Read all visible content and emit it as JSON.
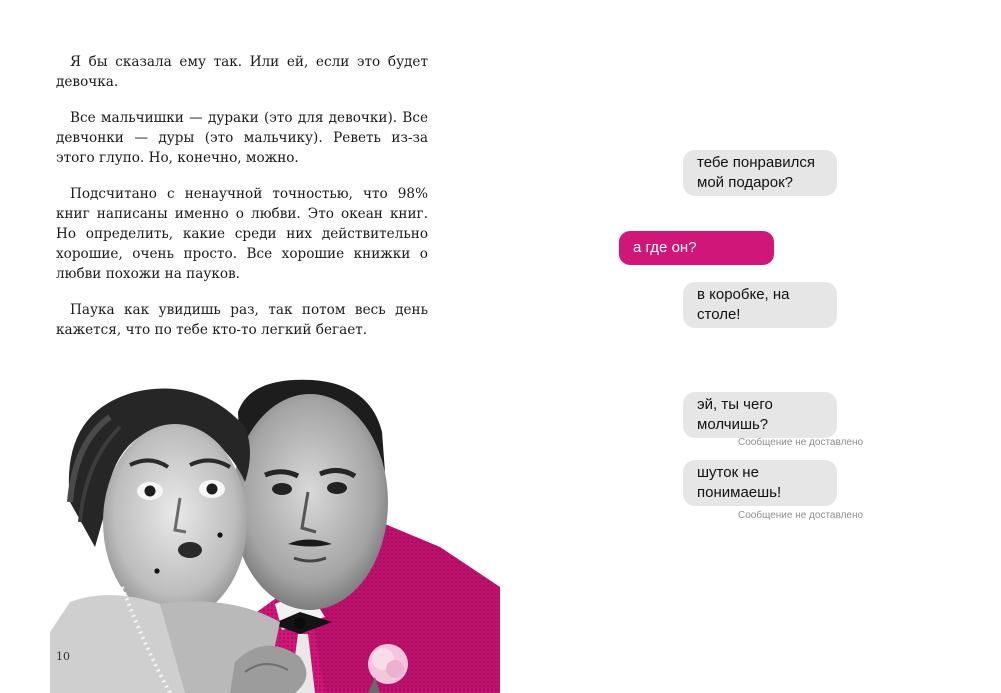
{
  "book": {
    "paragraphs": [
      "Я бы сказала ему так. Или ей, если это будет девочка.",
      "Все мальчишки — дураки (это для девочки). Все девчонки — дуры (это мальчику). Реветь из-за этого глупо. Но, конечно, можно.",
      "Подсчитано с ненаучной точностью, что 98% книг написаны именно о любви. Это океан книг. Но определить, какие среди них действительно хорошие, очень просто. Все хорошие книжки о любви похожи на пауков.",
      "Паука как увидишь раз, так потом весь день кажется, что по тебе кто-то легкий бегает."
    ],
    "page_number": "10"
  },
  "chat": {
    "messages": [
      {
        "from": "in",
        "text": "тебе понравился мой подарок?",
        "status": ""
      },
      {
        "from": "out",
        "text": "а где он?",
        "status": ""
      },
      {
        "from": "in",
        "text": "в коробке, на столе!",
        "status": ""
      },
      {
        "from": "in",
        "text": "эй, ты чего молчишь?",
        "status": "Сообщение не доставлено"
      },
      {
        "from": "in",
        "text": "шуток не понимаешь!",
        "status": "Сообщение не доставлено"
      }
    ]
  },
  "colors": {
    "accent": "#d01678",
    "bubble_in": "#e6e6e6",
    "status_text": "#8e8e8e"
  }
}
